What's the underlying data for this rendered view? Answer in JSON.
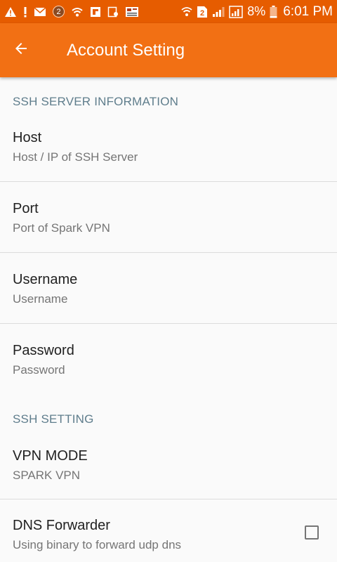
{
  "status_bar": {
    "badge_count_1": "2",
    "sim_badge": "2",
    "battery_percent": "8%",
    "time": "6:01 PM",
    "icons": [
      "warning-icon",
      "alert-icon",
      "mail-icon",
      "notification-count-icon",
      "wifi-calling-icon",
      "flipboard-icon",
      "screenshot-icon",
      "news-icon",
      "wifi-icon",
      "sim-icon",
      "signal-icon",
      "signal-icon",
      "battery-icon"
    ]
  },
  "app_bar": {
    "back_icon": "arrow-left-icon",
    "title": "Account Setting",
    "color": "#f27014"
  },
  "sections": [
    {
      "header": "SSH SERVER INFORMATION",
      "items": [
        {
          "title": "Host",
          "summary": "Host / IP of SSH Server"
        },
        {
          "title": "Port",
          "summary": "Port of Spark VPN"
        },
        {
          "title": "Username",
          "summary": "Username"
        },
        {
          "title": "Password",
          "summary": "Password"
        }
      ]
    },
    {
      "header": "SSH SETTING",
      "items": [
        {
          "title": "VPN MODE",
          "summary": "SPARK VPN"
        },
        {
          "title": "DNS Forwarder",
          "summary": "Using binary to forward udp dns",
          "checkbox": false
        }
      ]
    }
  ],
  "colors": {
    "status_bar": "#e65c00",
    "accent": "#f27014",
    "section_header": "#5f7d8c"
  }
}
